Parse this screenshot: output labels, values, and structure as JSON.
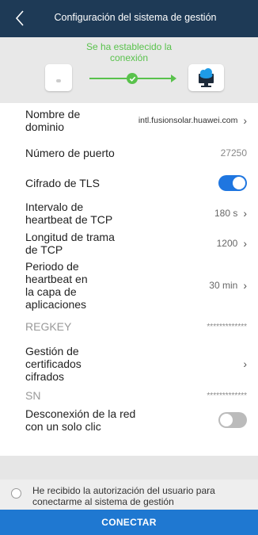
{
  "header": {
    "title": "Configuración del sistema de gestión",
    "back_icon": "chevron-left-icon"
  },
  "banner": {
    "status_line1": "Se ha establecido la",
    "status_line2": "conexión",
    "status_color": "#59c24c"
  },
  "settings": {
    "domain": {
      "label_line1": "Nombre de",
      "label_line2": "dominio",
      "value": "intl.fusionsolar.huawei.com"
    },
    "port": {
      "label": "Número de puerto",
      "value": "27250"
    },
    "tls": {
      "label": "Cifrado de TLS",
      "enabled": true
    },
    "tcp_heartbeat": {
      "label_line1": "Intervalo de",
      "label_line2": "heartbeat de TCP",
      "value": "180 s"
    },
    "tcp_frame": {
      "label_line1": "Longitud de trama",
      "label_line2": "de TCP",
      "value": "1200"
    },
    "app_heartbeat": {
      "label_line1": "Periodo de",
      "label_line2": "heartbeat en",
      "label_line3": "la capa de",
      "label_line4": "aplicaciones",
      "value": "30 min"
    },
    "regkey": {
      "label": "REGKEY",
      "value": "*************"
    },
    "certs": {
      "label_line1": "Gestión de",
      "label_line2": "certificados",
      "label_line3": "cifrados"
    },
    "sn": {
      "label": "SN",
      "value": "*************"
    },
    "disconnect": {
      "label_line1": "Desconexión de la red",
      "label_line2": "con un solo clic",
      "enabled": false
    }
  },
  "auth": {
    "text_line1": "He recibido la autorización del usuario para",
    "text_line2": "conectarme al sistema de gestión"
  },
  "button": {
    "connect_label": "CONECTAR"
  },
  "colors": {
    "header_bg": "#1e3a56",
    "accent": "#1f78d1",
    "toggle_on": "#1f76e0"
  }
}
